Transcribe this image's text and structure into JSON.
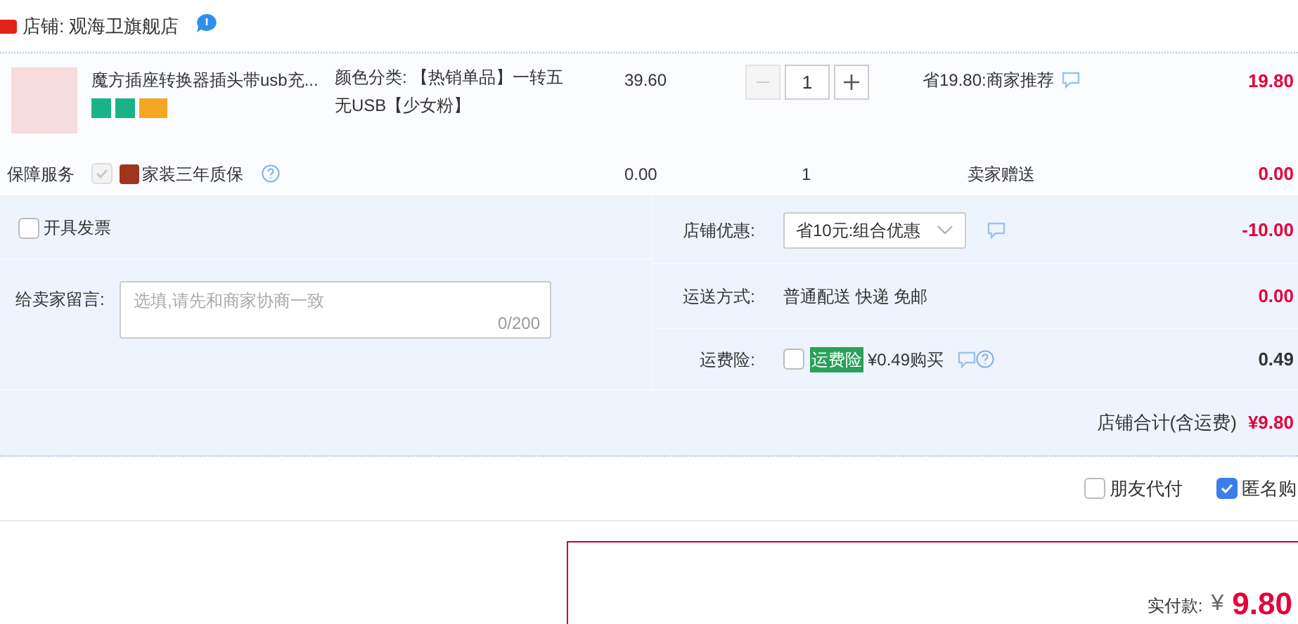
{
  "store": {
    "name": "店铺: 观海卫旗舰店"
  },
  "item": {
    "title": "魔方插座转换器插头带usb充...",
    "sku": "颜色分类: 【热销单品】一转五无USB【少女粉】",
    "price": "39.60",
    "quantity": "1",
    "promo": "省19.80:商家推荐",
    "subtotal": "19.80"
  },
  "service": {
    "label": "保障服务",
    "checked": true,
    "disabled": true,
    "name": "家装三年质保",
    "price": "0.00",
    "quantity": "1",
    "gift": "卖家赠送",
    "subtotal": "0.00"
  },
  "invoice": {
    "label": "开具发票",
    "checked": false
  },
  "message": {
    "label": "给卖家留言:",
    "placeholder": "选填,请先和商家协商一致",
    "counter": "0/200"
  },
  "discount": {
    "label": "店铺优惠:",
    "value": "省10元:组合优惠",
    "amount": "-10.00"
  },
  "shipping": {
    "label": "运送方式:",
    "value": "普通配送 快递 免邮",
    "amount": "0.00"
  },
  "insurance": {
    "label": "运费险:",
    "checked": false,
    "tag": "运费险",
    "text": "¥0.49购买",
    "amount": "0.49"
  },
  "total": {
    "label": "店铺合计(含运费)",
    "amount": "¥9.80"
  },
  "options": [
    {
      "label": "朋友代付",
      "checked": false
    },
    {
      "label": "匿名购",
      "checked": true
    }
  ],
  "payment": {
    "label": "实付款:",
    "currency": "¥",
    "amount": "9.80"
  }
}
